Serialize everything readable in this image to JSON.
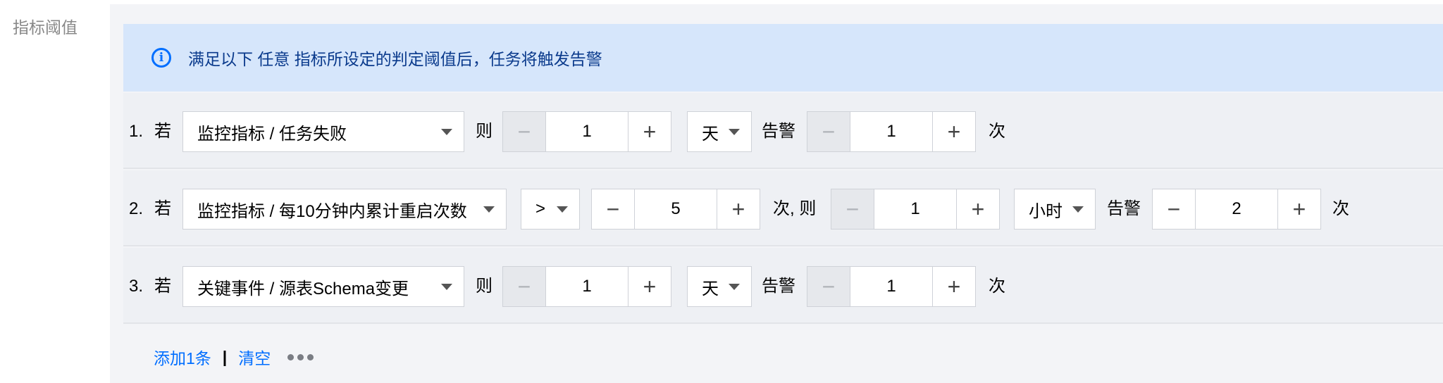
{
  "field_label": "指标阈值",
  "notice": {
    "icon": "info-icon",
    "text": "满足以下 任意 指标所设定的判定阈值后，任务将触发告警"
  },
  "rules": [
    {
      "index": "1.",
      "if_label": "若",
      "metric": "监控指标 / 任务失败",
      "then_label": "则",
      "period_value": "1",
      "period_unit": "天",
      "alarm_label": "告警",
      "times_value": "1",
      "times_label": "次"
    },
    {
      "index": "2.",
      "if_label": "若",
      "metric": "监控指标 / 每10分钟内累计重启次数",
      "operator": ">",
      "threshold_value": "5",
      "threshold_suffix": "次, 则",
      "period_value": "1",
      "period_unit": "小时",
      "alarm_label": "告警",
      "times_value": "2",
      "times_label": "次"
    },
    {
      "index": "3.",
      "if_label": "若",
      "metric": "关键事件 / 源表Schema变更",
      "then_label": "则",
      "period_value": "1",
      "period_unit": "天",
      "alarm_label": "告警",
      "times_value": "1",
      "times_label": "次"
    }
  ],
  "footer": {
    "add_label": "添加1条",
    "separator": "|",
    "clear_label": "清空",
    "more_icon": "more-dots-icon"
  },
  "colors": {
    "accent": "#006eff",
    "notice_bg": "#d6e6fb",
    "row_bg": "#eef0f4"
  }
}
